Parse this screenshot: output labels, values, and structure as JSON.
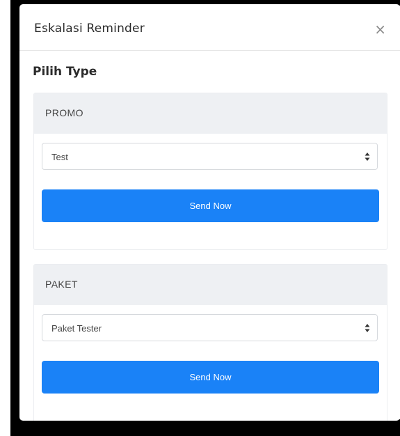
{
  "modal": {
    "title": "Eskalasi Reminder",
    "close_symbol": "×",
    "section_title": "Pilih Type"
  },
  "cards": [
    {
      "header": "PROMO",
      "selected_option": "Test",
      "button_label": "Send Now"
    },
    {
      "header": "PAKET",
      "selected_option": "Paket Tester",
      "button_label": "Send Now"
    }
  ],
  "colors": {
    "primary": "#1a82f7",
    "card_header_bg": "#eef0f3"
  },
  "icons": {
    "close": "close-icon",
    "select_arrow": "sort-arrows-icon"
  }
}
